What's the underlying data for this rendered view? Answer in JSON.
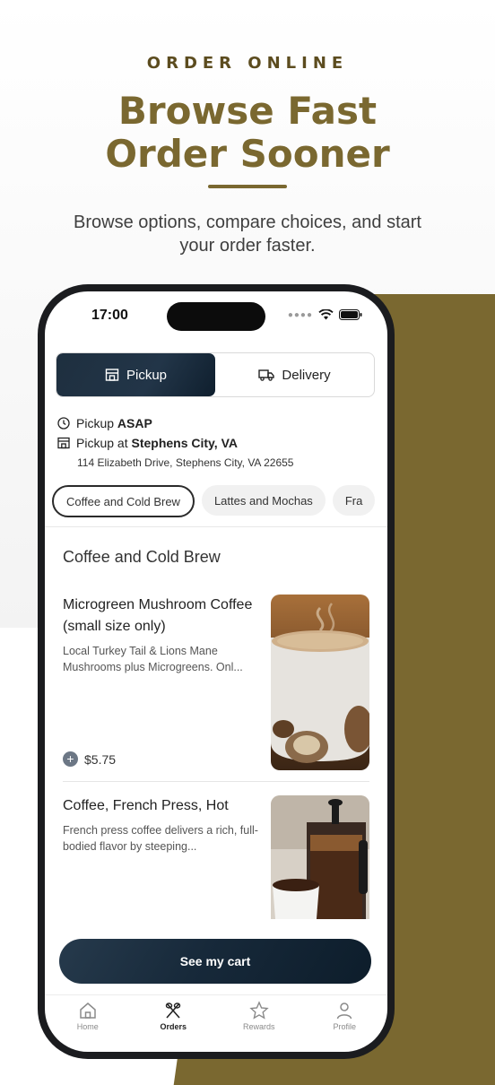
{
  "hero": {
    "kicker": "ORDER ONLINE",
    "headline_line1": "Browse Fast",
    "headline_line2": "Order Sooner",
    "subtitle": "Browse options, compare choices, and start your order faster."
  },
  "status_bar": {
    "time": "17:00"
  },
  "order_mode": {
    "pickup_label": "Pickup",
    "delivery_label": "Delivery",
    "selected": "Pickup"
  },
  "pickup_info": {
    "time_prefix": "Pickup",
    "time_value": "ASAP",
    "location_prefix": "Pickup at",
    "location_value": "Stephens City, VA",
    "address": "114 Elizabeth Drive, Stephens City, VA 22655"
  },
  "categories": [
    {
      "label": "Coffee and Cold Brew",
      "active": true
    },
    {
      "label": "Lattes and Mochas",
      "active": false
    },
    {
      "label": "Fra",
      "active": false
    }
  ],
  "section_title": "Coffee and Cold Brew",
  "menu_items": [
    {
      "name": "Microgreen Mushroom Coffee (small size only)",
      "description": "Local Turkey Tail & Lions Mane Mushrooms plus Microgreens. Onl...",
      "price": "$5.75"
    },
    {
      "name": "Coffee, French Press, Hot",
      "description": "French press coffee delivers a rich, full-bodied flavor by steeping..."
    }
  ],
  "cart_button_label": "See my cart",
  "tabs": [
    {
      "label": "Home",
      "icon": "home-icon"
    },
    {
      "label": "Orders",
      "icon": "utensils-icon"
    },
    {
      "label": "Rewards",
      "icon": "star-icon"
    },
    {
      "label": "Profile",
      "icon": "profile-icon"
    }
  ],
  "colors": {
    "brand_gold": "#7a6830",
    "navy": "#17293a"
  }
}
